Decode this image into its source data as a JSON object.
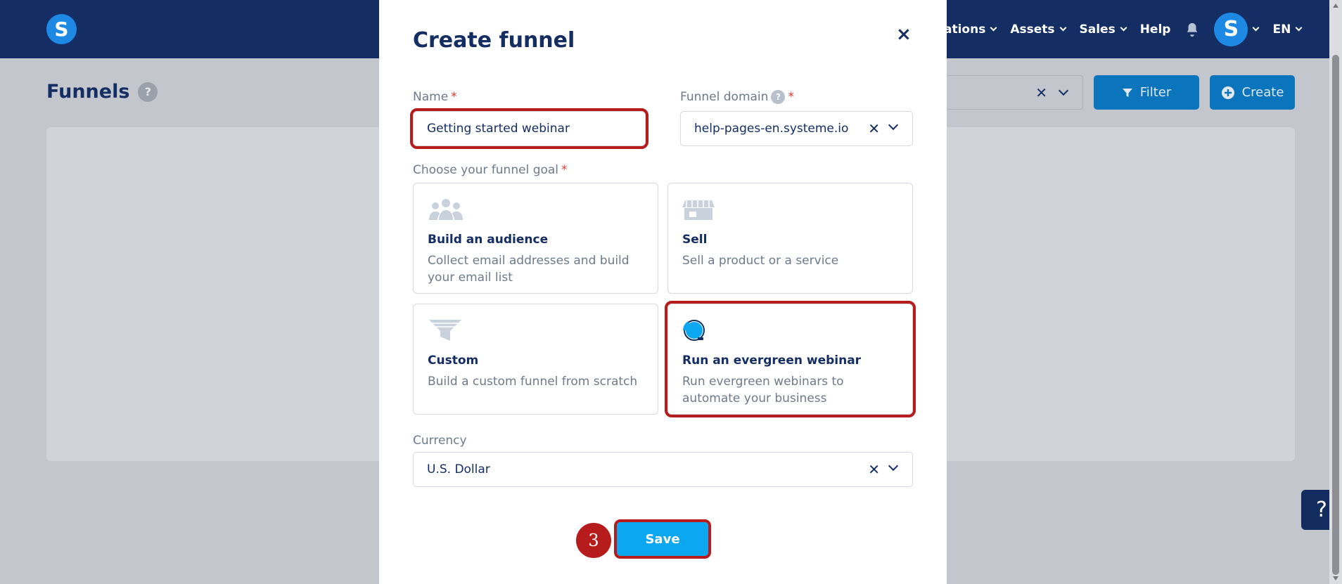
{
  "header": {
    "logo_letter": "S",
    "nav_items": [
      {
        "label": "ations"
      },
      {
        "label": "Assets"
      },
      {
        "label": "Sales"
      },
      {
        "label": "Help"
      }
    ],
    "avatar_letter": "S",
    "language": "EN"
  },
  "page": {
    "title": "Funnels",
    "help_badge": "?",
    "filter_clear": "✕",
    "filter_button": "Filter",
    "create_button": "Create"
  },
  "help_widget": "?",
  "modal": {
    "title": "Create funnel",
    "close_label": "×",
    "name_label": "Name",
    "name_value": "Getting started webinar",
    "domain_label": "Funnel domain",
    "domain_value": "help-pages-en.systeme.io",
    "goal_label": "Choose your funnel goal",
    "required_mark": "*",
    "goals": [
      {
        "title": "Build an audience",
        "description": "Collect email addresses and build your email list",
        "icon": "audience-icon"
      },
      {
        "title": "Sell",
        "description": "Sell a product or a service",
        "icon": "store-icon"
      },
      {
        "title": "Custom",
        "description": "Build a custom funnel from scratch",
        "icon": "funnel-icon"
      },
      {
        "title": "Run an evergreen webinar",
        "description": "Run evergreen webinars to automate your business",
        "icon": "webinar-icon"
      }
    ],
    "currency_label": "Currency",
    "currency_value": "U.S. Dollar",
    "clear_symbol": "✕",
    "save_button": "Save",
    "step_number": "3"
  },
  "colors": {
    "navy": "#142d63",
    "accent_blue": "#0ba7f0",
    "highlight_red": "#b71c1c",
    "overlay_bg": "#c3c6cc"
  }
}
